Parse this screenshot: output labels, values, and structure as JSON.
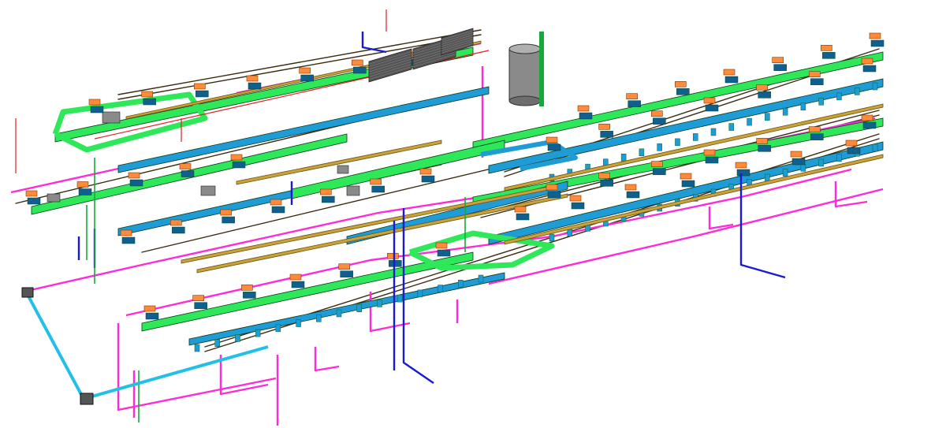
{
  "diagram": {
    "type": "isometric-mep-model",
    "text_labels": [],
    "system_colors": {
      "supply_duct": "#2ee85a",
      "supply_duct_dark": "#17a83c",
      "return_duct": "#1f9bd6",
      "return_duct_dark": "#0f5f8f",
      "cable_tray": "#c9a23a",
      "cable_tray_dark": "#6b5316",
      "drain_pipe": "#ff2bd6",
      "domestic_water": "#1a1ad0",
      "fire_pipe": "#e02020",
      "terminal_box": "#ff8a3a",
      "equipment": "#8a8a8a",
      "structure_line": "#3a2a10",
      "main_pipe_cyan": "#22c0e8"
    },
    "components": {
      "storage_tank": "cylinder-tank",
      "roof_grilles": "grille-panels",
      "main_header": "cyan-main-pipe"
    }
  }
}
